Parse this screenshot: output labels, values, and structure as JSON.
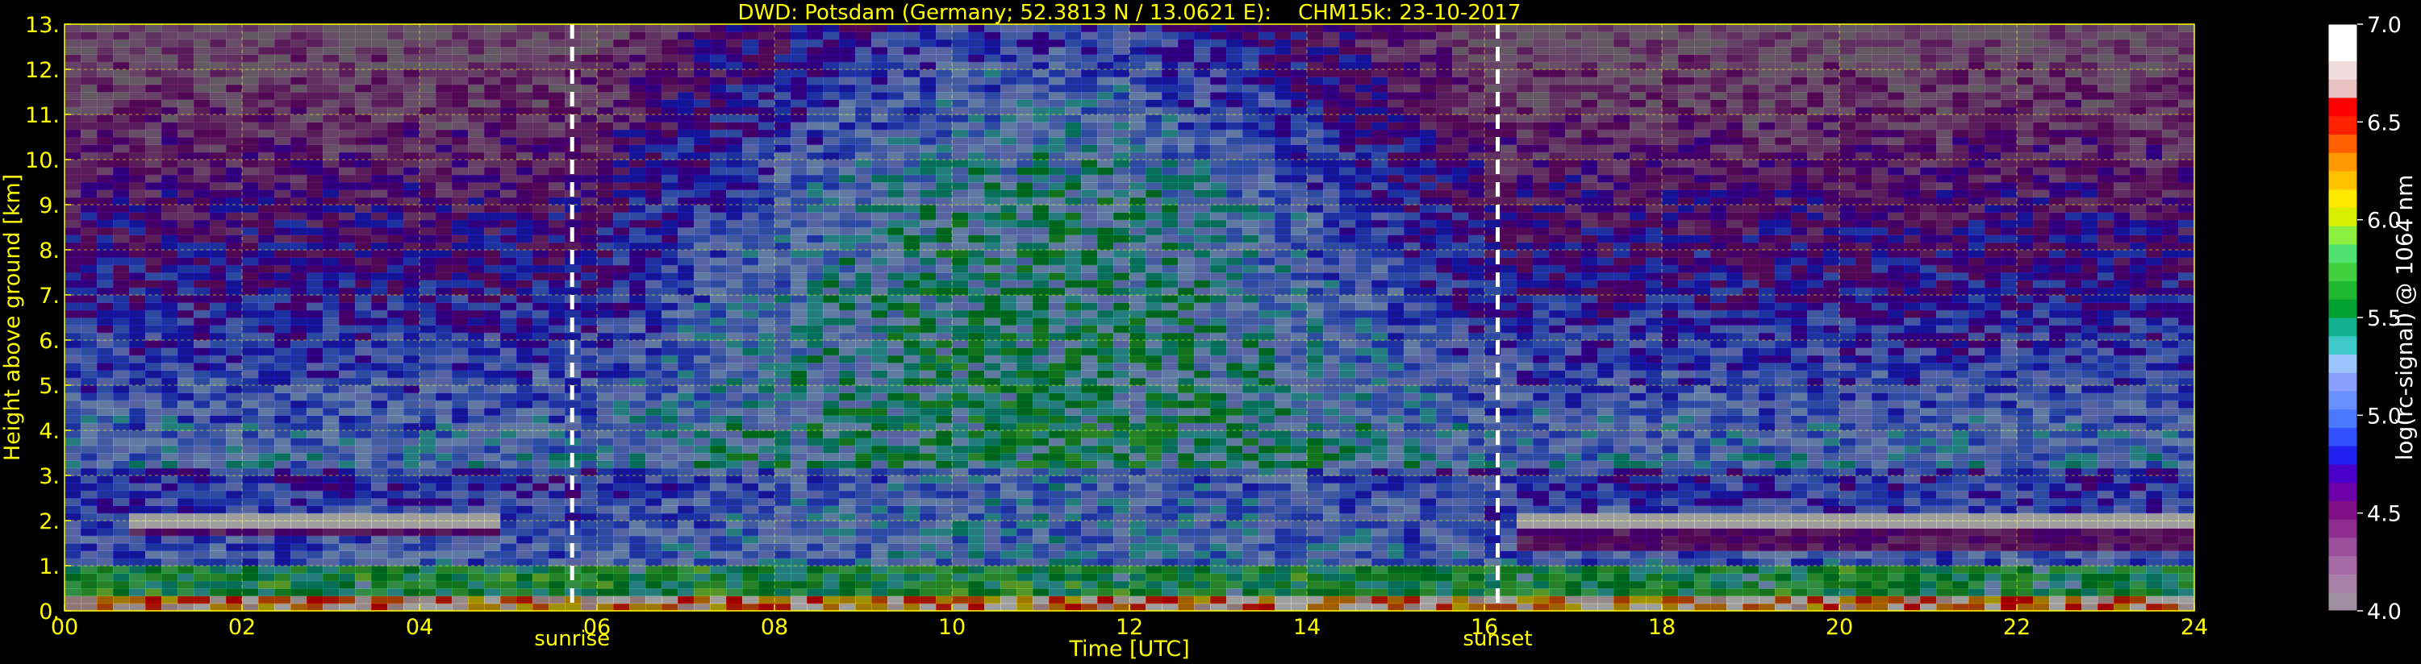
{
  "chart_data": {
    "type": "heatmap",
    "title": "DWD: Potsdam (Germany; 52.3813 N / 13.0621 E):    CHM15k: 23-10-2017",
    "xlabel": "Time [UTC]",
    "ylabel": "Height above ground [km]",
    "xlim": [
      0,
      24
    ],
    "ylim": [
      0,
      13
    ],
    "x_ticks": [
      0,
      2,
      4,
      6,
      8,
      10,
      12,
      14,
      16,
      18,
      20,
      22,
      24
    ],
    "x_tick_labels": [
      "00",
      "02",
      "04",
      "06",
      "08",
      "10",
      "12",
      "14",
      "16",
      "18",
      "20",
      "22",
      "24"
    ],
    "y_ticks": [
      0,
      1,
      2,
      3,
      4,
      5,
      6,
      7,
      8,
      9,
      10,
      11,
      12,
      13
    ],
    "y_tick_labels": [
      "0.",
      "1.",
      "2.",
      "3.",
      "4.",
      "5.",
      "6.",
      "7.",
      "8.",
      "9.",
      "10.",
      "11.",
      "12.",
      "13."
    ],
    "grid": true,
    "markers": [
      {
        "label": "sunrise",
        "x": 5.72
      },
      {
        "label": "sunset",
        "x": 16.15
      }
    ],
    "colorbar": {
      "label": "log(rc-signal) @ 1064 nm",
      "min": 4.0,
      "max": 7.0,
      "ticks": [
        4.0,
        4.5,
        5.0,
        5.5,
        6.0,
        6.5,
        7.0
      ],
      "tick_labels": [
        "4.0",
        "4.5",
        "5.0",
        "5.5",
        "6.0",
        "6.5",
        "7.0"
      ],
      "colors": [
        "#a08fa0",
        "#a77fa7",
        "#a56aa5",
        "#9a4f9a",
        "#8e2d8e",
        "#800f86",
        "#6a00a6",
        "#4a00c8",
        "#2020f0",
        "#3050ff",
        "#4a78ff",
        "#6a8fff",
        "#8aa0ff",
        "#9cc4ff",
        "#3ec8c8",
        "#10b090",
        "#00a030",
        "#20b830",
        "#40d040",
        "#50e070",
        "#8cef40",
        "#d8f000",
        "#ffe800",
        "#ffc000",
        "#ff9800",
        "#ff6000",
        "#ff2000",
        "#ff0000",
        "#e8c0c0",
        "#f0dcdc",
        "#ffffff",
        "#ffffff"
      ]
    },
    "features": [
      {
        "name": "boundary layer aerosol",
        "x": [
          0,
          24
        ],
        "height_km": [
          0,
          0.95
        ]
      },
      {
        "name": "cloud layer",
        "x": [
          0.8,
          4.9
        ],
        "height_km": [
          1.6,
          1.95
        ]
      },
      {
        "name": "cloud layer",
        "x": [
          16.3,
          24
        ],
        "height_km": [
          1.3,
          1.95
        ]
      }
    ]
  },
  "colors": {
    "axis_text": "#ffff00",
    "background": "#000000",
    "grid": "#ffff00",
    "colorbar_text": "#ffffff",
    "marker_line": "#ffffff"
  }
}
